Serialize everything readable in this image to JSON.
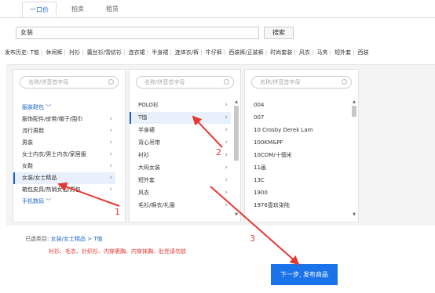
{
  "tabs": [
    "一口价",
    "拍卖",
    "租赁"
  ],
  "search": {
    "value": "女装",
    "button": "搜索"
  },
  "history": {
    "label": "发布历史:",
    "items": [
      "T恤",
      "休闲裤",
      "衬衫",
      "蕾丝衫/雪纺衫",
      "连衣裙",
      "半身裙",
      "连体衣/裤",
      "牛仔裤",
      "西装裤/正装裤",
      "时尚套装",
      "风衣",
      "马夹",
      "短外套",
      "西装"
    ]
  },
  "filter_placeholder": "名称/拼音首字母",
  "col1": {
    "group1": "服装鞋包",
    "items": [
      "服饰配件/皮带/帽子/围巾",
      "流行男鞋",
      "男装",
      "女士内衣/男士内衣/家居服",
      "女鞋",
      "女装/女士精品",
      "箱包皮具/热销女包/男包"
    ],
    "group2": "手机数码"
  },
  "col2": {
    "items": [
      "POLO衫",
      "T恤",
      "半身裙",
      "背心吊带",
      "衬衫",
      "大码女装",
      "短外套",
      "风衣",
      "毛衫/棉衣/礼服"
    ]
  },
  "col3": {
    "items": [
      "004",
      "007",
      "10 Crosby Derek Lam",
      "100KM&PF",
      "10COM/十個米",
      "11画",
      "13C",
      "1900",
      "1976壹玖柒陆"
    ]
  },
  "selected": {
    "label": "已选类目:",
    "path": "女装/女士精品 > T恤"
  },
  "tips": "衬衫、毛衣、针织衫、内穿裹胸、内穿抹胸、肚兜请勿放",
  "next_button": "下一步, 发布商品",
  "annotations": [
    "1",
    "2",
    "3"
  ],
  "colors": {
    "accent": "#1a66c9",
    "button": "#1a73e8",
    "annotation": "#e53935"
  }
}
